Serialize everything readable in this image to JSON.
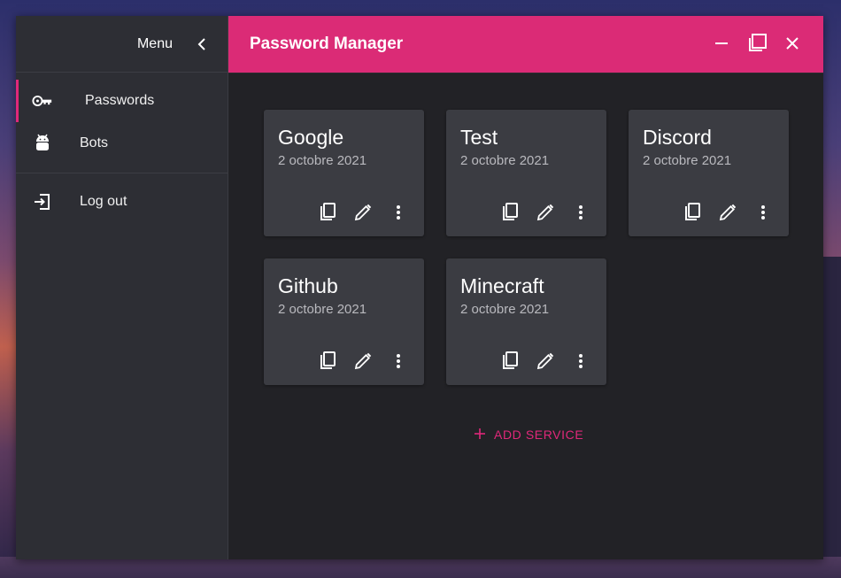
{
  "sidebar": {
    "menu_label": "Menu",
    "items": [
      {
        "label": "Passwords",
        "icon": "key-icon",
        "active": true
      },
      {
        "label": "Bots",
        "icon": "android-icon",
        "active": false
      }
    ],
    "logout_label": "Log out"
  },
  "header": {
    "title": "Password Manager"
  },
  "services": [
    {
      "name": "Google",
      "date": "2 octobre 2021"
    },
    {
      "name": "Test",
      "date": "2 octobre 2021"
    },
    {
      "name": "Discord",
      "date": "2 octobre 2021"
    },
    {
      "name": "Github",
      "date": "2 octobre 2021"
    },
    {
      "name": "Minecraft",
      "date": "2 octobre 2021"
    }
  ],
  "add_service_label": "ADD SERVICE",
  "colors": {
    "accent": "#db2b76",
    "sidebar_bg": "#2d2e34",
    "content_bg": "#222226",
    "card_bg": "#3b3c42"
  }
}
